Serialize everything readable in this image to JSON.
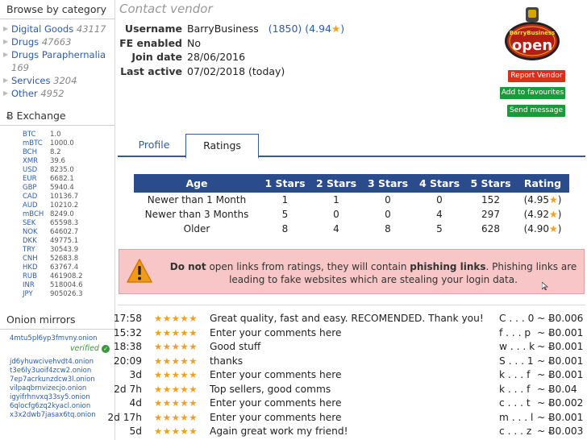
{
  "sidebar": {
    "browse_title": "Browse by category",
    "categories": [
      {
        "name": "Digital Goods",
        "count": "43117"
      },
      {
        "name": "Drugs",
        "count": "47663"
      },
      {
        "name": "Drugs Paraphernalia",
        "count": "169"
      },
      {
        "name": "Services",
        "count": "3204"
      },
      {
        "name": "Other",
        "count": "4952"
      }
    ],
    "exchange_title": "Ƀ Exchange",
    "exchange": [
      {
        "cur": "BTC",
        "val": "1.0"
      },
      {
        "cur": "mBTC",
        "val": "1000.0"
      },
      {
        "cur": "BCH",
        "val": "8.2"
      },
      {
        "cur": "XMR",
        "val": "39.6"
      },
      {
        "cur": "USD",
        "val": "8235.0"
      },
      {
        "cur": "EUR",
        "val": "6682.1"
      },
      {
        "cur": "GBP",
        "val": "5940.4"
      },
      {
        "cur": "CAD",
        "val": "10136.7"
      },
      {
        "cur": "AUD",
        "val": "10210.2"
      },
      {
        "cur": "mBCH",
        "val": "8249.0"
      },
      {
        "cur": "SEK",
        "val": "65598.3"
      },
      {
        "cur": "NOK",
        "val": "64602.7"
      },
      {
        "cur": "DKK",
        "val": "49775.1"
      },
      {
        "cur": "TRY",
        "val": "30543.9"
      },
      {
        "cur": "CNH",
        "val": "52683.8"
      },
      {
        "cur": "HKD",
        "val": "63767.4"
      },
      {
        "cur": "RUB",
        "val": "461908.2"
      },
      {
        "cur": "INR",
        "val": "518004.6"
      },
      {
        "cur": "JPY",
        "val": "905026.3"
      }
    ],
    "mirrors_title": "Onion mirrors",
    "main_mirror": "4mtu5pl6yp3fmvny.onion",
    "verified_label": "verified",
    "mirrors": [
      "jd6yhuwcivehvdt4.onion",
      "t3e6ly3uoif4zcw2.onion",
      "7ep7acrkunzdcw3l.onion",
      "vilpaqbrnvizecjo.onion",
      "igyifrhnvxq33sy5.onion",
      "6qlocfg6zq2kyacl.onion",
      "x3x2dwb7jasax6tq.onion"
    ]
  },
  "vendor": {
    "section_title": "Contact vendor",
    "labels": {
      "username": "Username",
      "fe": "FE enabled",
      "join": "Join date",
      "last": "Last active"
    },
    "username": "BarryBusiness",
    "rating_count": "(1850)",
    "rating_score": "(4.94",
    "rating_close": ")",
    "fe_enabled": "No",
    "join_date": "28/06/2016",
    "last_active": "07/02/2018 (today)",
    "logo_top_text": "BarryBusiness",
    "logo_main_text": "open",
    "buttons": {
      "report": "Report Vendor",
      "fav": "Add to favourites",
      "msg": "Send message"
    }
  },
  "tabs": [
    "Profile",
    "Ratings"
  ],
  "ratings_table": {
    "headers": [
      "Age",
      "1 Stars",
      "2 Stars",
      "3 Stars",
      "4 Stars",
      "5 Stars",
      "Rating"
    ],
    "rows": [
      {
        "age": "Newer than 1 Month",
        "s1": "1",
        "s2": "1",
        "s3": "0",
        "s4": "0",
        "s5": "152",
        "rating": "(4.95",
        "rclose": ")"
      },
      {
        "age": "Newer than 3 Months",
        "s1": "5",
        "s2": "0",
        "s3": "0",
        "s4": "4",
        "s5": "297",
        "rating": "(4.92",
        "rclose": ")"
      },
      {
        "age": "Older",
        "s1": "8",
        "s2": "4",
        "s3": "8",
        "s4": "5",
        "s5": "628",
        "rating": "(4.90",
        "rclose": ")"
      }
    ]
  },
  "warning": {
    "bold1": "Do not",
    "text1": " open links from ratings, they will contain ",
    "bold2": "phishing links",
    "text2": ". Phishing links are leading to fake websites which are stealing your login data."
  },
  "reviews": [
    {
      "time": "17:58",
      "stars": "★★★★★",
      "comment": "Great quality, fast and easy. RECOMENDED. Thank you!",
      "user": "C . . . 0",
      "price": "~ Ƀ0.006"
    },
    {
      "time": "15:32",
      "stars": "★★★★★",
      "comment": "Enter your comments here",
      "user": "f . . . p",
      "price": "~ Ƀ0.001"
    },
    {
      "time": "18:38",
      "stars": "★★★★★",
      "comment": "Good stuff",
      "user": "w . . . k",
      "price": "~ Ƀ0.001"
    },
    {
      "time": "20:09",
      "stars": "★★★★★",
      "comment": "thanks",
      "user": "S . . . 1",
      "price": "~ Ƀ0.001"
    },
    {
      "time": "3d",
      "stars": "★★★★★",
      "comment": "Enter your comments here",
      "user": "k . . . f",
      "price": "~ Ƀ0.001"
    },
    {
      "time": "2d 7h",
      "stars": "★★★★★",
      "comment": "Top sellers, good comms",
      "user": "k . . . f",
      "price": "~ Ƀ0.04"
    },
    {
      "time": "4d",
      "stars": "★★★★★",
      "comment": "Enter your comments here",
      "user": "c . . . t",
      "price": "~ Ƀ0.002"
    },
    {
      "time": "2d 17h",
      "stars": "★★★★★",
      "comment": "Enter your comments here",
      "user": "m . . . l",
      "price": "~ Ƀ0.001"
    },
    {
      "time": "5d",
      "stars": "★★★★★",
      "comment": "Again great work my friend!",
      "user": "c . . . z",
      "price": "~ Ƀ0.003"
    }
  ],
  "colors": {
    "accent": "#2a4c8c",
    "star": "#f0a020",
    "danger": "#d9301e",
    "success": "#199b3a",
    "warning_bg": "#f8c6c6"
  }
}
